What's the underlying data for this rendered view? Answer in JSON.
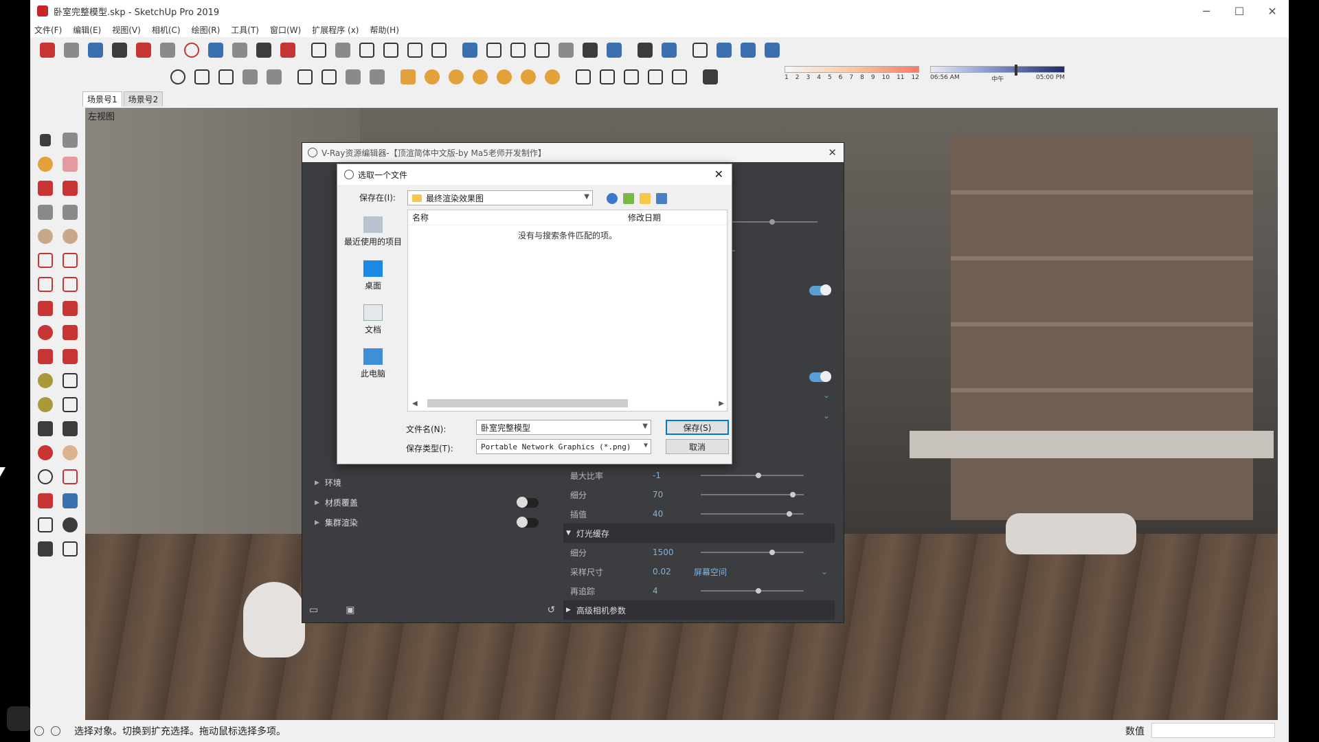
{
  "window": {
    "title": "卧室完整模型.skp - SketchUp Pro 2019",
    "minimize": "─",
    "maximize": "☐",
    "close": "✕"
  },
  "menu": [
    "文件(F)",
    "编辑(E)",
    "视图(V)",
    "相机(C)",
    "绘图(R)",
    "工具(T)",
    "窗口(W)",
    "扩展程序 (x)",
    "帮助(H)"
  ],
  "shadow_months": [
    "1",
    "2",
    "3",
    "4",
    "5",
    "6",
    "7",
    "8",
    "9",
    "10",
    "11",
    "12"
  ],
  "time_bar": {
    "start": "06:56 AM",
    "mid": "中午",
    "end": "05:00 PM"
  },
  "scene_tabs": [
    "场景号1",
    "场景号2"
  ],
  "viewport": {
    "label": "左视图"
  },
  "vray_editor": {
    "title": "V-Ray资源编辑器-【顶渲简体中文版-by Ma5老师开发制作】",
    "left_rows": [
      {
        "label": "环境",
        "toggle": null
      },
      {
        "label": "材质覆盖",
        "toggle": false
      },
      {
        "label": "集群渲染",
        "toggle": false
      }
    ],
    "right_rows": [
      {
        "label": "最大比率",
        "value": "-1"
      },
      {
        "label": "细分",
        "value": "70"
      },
      {
        "label": "插值",
        "value": "40"
      }
    ],
    "light_cache": {
      "section": "灯光缓存",
      "rows": [
        {
          "label": "细分",
          "value": "1500"
        },
        {
          "label": "采样尺寸",
          "value": "0.02",
          "dropdown": "屏幕空间"
        },
        {
          "label": "再追踪",
          "value": "4"
        }
      ]
    },
    "advanced_camera": "高级相机参数"
  },
  "dialog": {
    "title": "选取一个文件",
    "save_in_label": "保存在(I):",
    "save_in_value": "最终渲染效果图",
    "places": [
      "最近使用的项目",
      "桌面",
      "文档",
      "此电脑"
    ],
    "col_name": "名称",
    "col_date": "修改日期",
    "empty_message": "没有与搜索条件匹配的项。",
    "filename_label": "文件名(N):",
    "filename_value": "卧室完整模型",
    "filetype_label": "保存类型(T):",
    "filetype_value": "Portable Network Graphics (*.png)",
    "save_button": "保存(S)",
    "cancel_button": "取消"
  },
  "status": {
    "text": "选择对象。切换到扩充选择。拖动鼠标选择多项。",
    "value_label": "数值"
  }
}
